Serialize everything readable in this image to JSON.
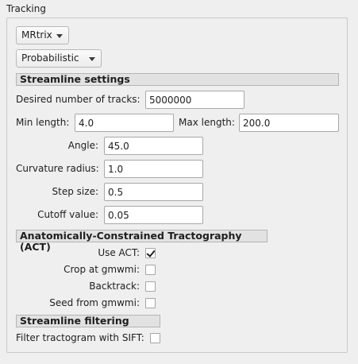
{
  "group": {
    "title": "Tracking"
  },
  "algorithm": {
    "software": "MRtrix",
    "method": "Probabilistic"
  },
  "streamline_settings": {
    "header": "Streamline settings",
    "desired_tracks_label": "Desired number of tracks:",
    "desired_tracks_value": "5000000",
    "min_length_label": "Min length:",
    "min_length_value": "4.0",
    "max_length_label": "Max length:",
    "max_length_value": "200.0",
    "angle_label": "Angle:",
    "angle_value": "45.0",
    "curvature_label": "Curvature radius:",
    "curvature_value": "1.0",
    "step_label": "Step size:",
    "step_value": "0.5",
    "cutoff_label": "Cutoff value:",
    "cutoff_value": "0.05"
  },
  "act": {
    "header": "Anatomically-Constrained Tractography (ACT)",
    "use_act_label": "Use ACT:",
    "use_act_checked": true,
    "crop_label": "Crop at gmwmi:",
    "crop_checked": false,
    "backtrack_label": "Backtrack:",
    "backtrack_checked": false,
    "seed_label": "Seed from gmwmi:",
    "seed_checked": false
  },
  "filtering": {
    "header": "Streamline filtering",
    "sift_label": "Filter tractogram with SIFT:",
    "sift_checked": false
  }
}
